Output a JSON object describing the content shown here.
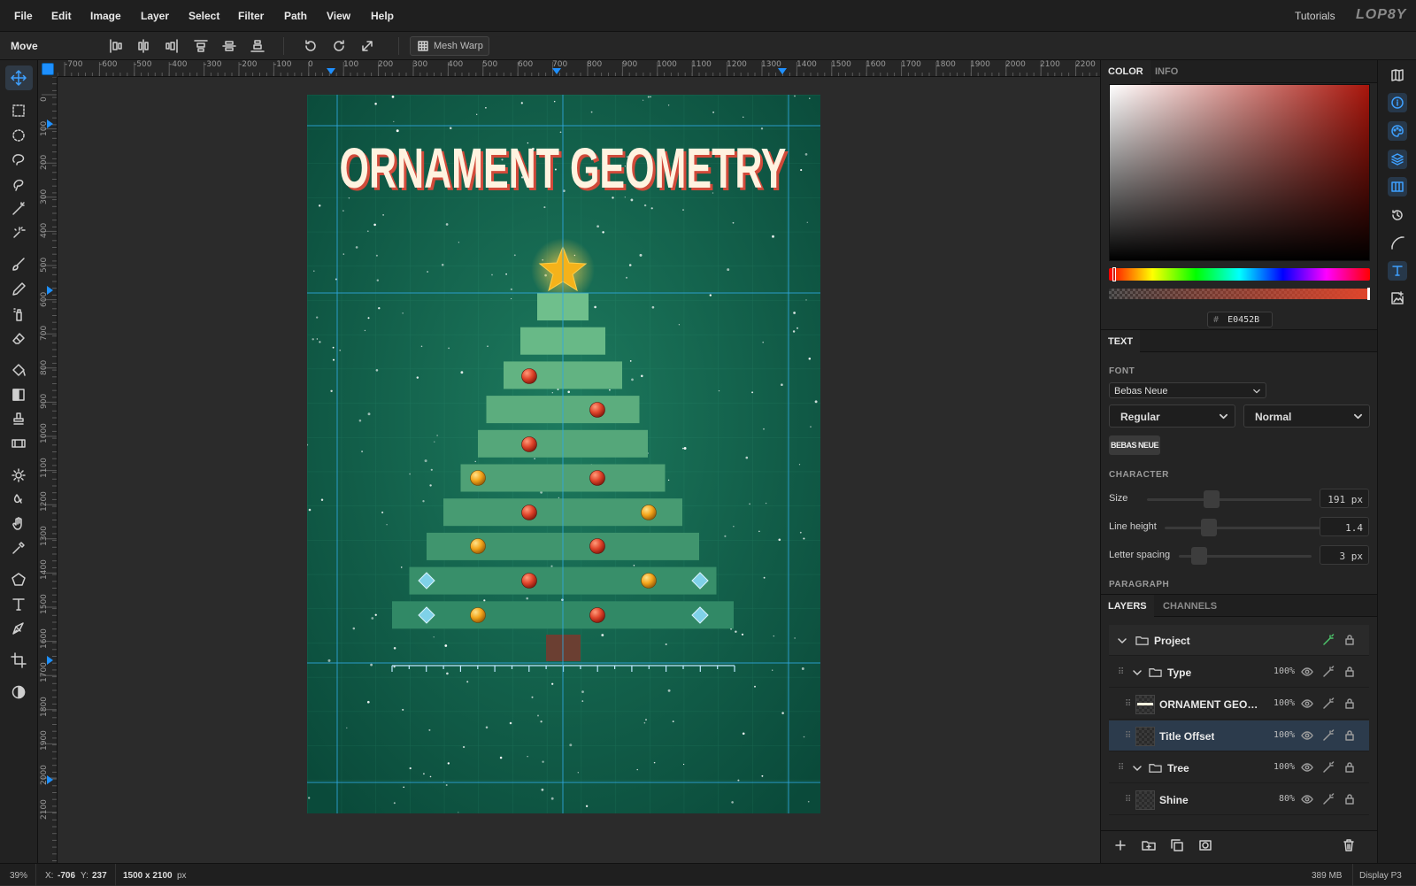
{
  "menubar": {
    "items": [
      "File",
      "Edit",
      "Image",
      "Layer",
      "Select",
      "Filter",
      "Path",
      "View",
      "Help"
    ],
    "tutorials": "Tutorials",
    "logo": "LOP8Y"
  },
  "options": {
    "tool_name": "Move",
    "mesh_warp": "Mesh Warp"
  },
  "rulers": {
    "h_labels": [
      "-700",
      "-600",
      "-500",
      "-400",
      "-300",
      "-200",
      "-100",
      "0",
      "100",
      "200",
      "300",
      "400",
      "500",
      "600",
      "700",
      "800",
      "900",
      "1000",
      "1100",
      "1200",
      "1300",
      "1400",
      "1500",
      "1600",
      "1700",
      "1800",
      "1900",
      "2000",
      "2100",
      "2200"
    ],
    "v_labels": [
      "0",
      "100",
      "200",
      "300",
      "400",
      "500",
      "600",
      "700",
      "800",
      "900",
      "1000",
      "1100",
      "1200",
      "1300",
      "1400",
      "1500",
      "1600",
      "1700",
      "1800",
      "1900",
      "2000",
      "2100"
    ]
  },
  "canvas": {
    "title": "ORNAMENT GEOMETRY",
    "background_color": "#0a4a3a",
    "title_fill": "#fff3e0",
    "title_shadow": "#d14a3a",
    "star_color": "#f5b21a",
    "tier_color": "#5aaf7e",
    "trunk_color": "#6b3f32",
    "ornament_red": "#e0452b",
    "ornament_gold": "#f3a51b",
    "ornament_diamond": "#7fd1e8"
  },
  "color_panel": {
    "tabs": [
      "COLOR",
      "INFO"
    ],
    "hex_prefix": "#",
    "hex": "E0452B",
    "swatch_color": "#E0452B"
  },
  "text_panel": {
    "tab": "TEXT",
    "font_label": "FONT",
    "font": "Bebas Neue",
    "style": "Regular",
    "weight": "Normal",
    "font_preview": "BEBAS NEUE",
    "character_label": "CHARACTER",
    "size_label": "Size",
    "size_value": "191 px",
    "line_height_label": "Line height",
    "line_height_value": "1.4",
    "letter_spacing_label": "Letter spacing",
    "letter_spacing_value": "3 px",
    "paragraph_label": "PARAGRAPH"
  },
  "layers_panel": {
    "tabs": [
      "LAYERS",
      "CHANNELS"
    ],
    "layers": [
      {
        "name": "Project",
        "opacity": "",
        "kind": "group",
        "indent": 0
      },
      {
        "name": "Type",
        "opacity": "100%",
        "kind": "group",
        "indent": 1
      },
      {
        "name": "ORNAMENT GEOM...",
        "opacity": "100%",
        "kind": "text",
        "indent": 2
      },
      {
        "name": "Title Offset",
        "opacity": "100%",
        "kind": "layer",
        "indent": 2,
        "selected": true
      },
      {
        "name": "Tree",
        "opacity": "100%",
        "kind": "group",
        "indent": 1
      },
      {
        "name": "Shine",
        "opacity": "80%",
        "kind": "layer",
        "indent": 2
      }
    ]
  },
  "status": {
    "zoom": "39%",
    "x_label": "X:",
    "x_value": "-706",
    "y_label": "Y:",
    "y_value": "237",
    "doc_size": "1500 x 2100",
    "doc_unit": "px",
    "memory": "389 MB",
    "color_profile": "Display P3"
  }
}
